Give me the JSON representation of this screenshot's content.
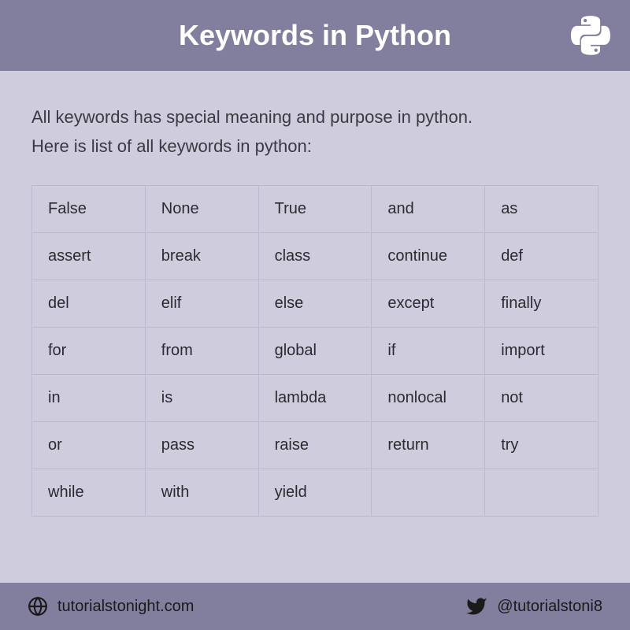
{
  "header": {
    "title": "Keywords in Python"
  },
  "intro": {
    "line1": "All keywords has special meaning and purpose in python.",
    "line2": "Here is list of all keywords in python:"
  },
  "keywords": [
    [
      "False",
      "None",
      "True",
      "and",
      "as"
    ],
    [
      "assert",
      "break",
      "class",
      "continue",
      "def"
    ],
    [
      "del",
      "elif",
      "else",
      "except",
      "finally"
    ],
    [
      "for",
      "from",
      "global",
      "if",
      "import"
    ],
    [
      "in",
      "is",
      "lambda",
      "nonlocal",
      "not"
    ],
    [
      "or",
      "pass",
      "raise",
      "return",
      "try"
    ],
    [
      "while",
      "with",
      "yield",
      "",
      ""
    ]
  ],
  "footer": {
    "website": "tutorialstonight.com",
    "twitter_handle": "@tutorialstoni8"
  }
}
